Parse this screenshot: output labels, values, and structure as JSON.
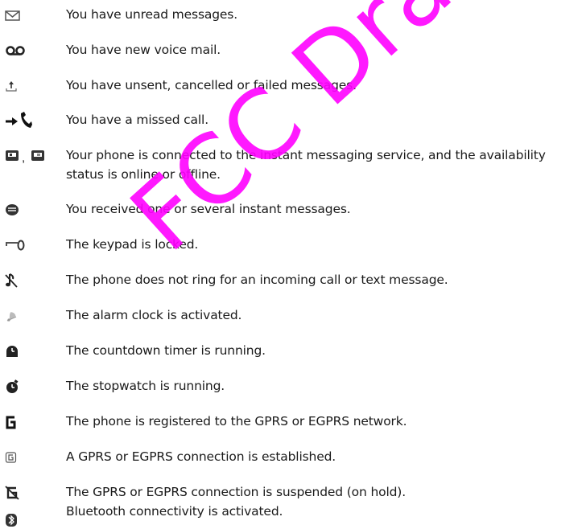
{
  "watermark": {
    "text": "FCC Draft",
    "color": "#ff00ff"
  },
  "items": [
    {
      "icon": "envelope-icon",
      "text": "You have unread messages."
    },
    {
      "icon": "voicemail-icon",
      "text": "You have new voice mail."
    },
    {
      "icon": "outbox-icon",
      "text": "You have unsent, cancelled or failed messages."
    },
    {
      "icon": "missed-call-icon",
      "text": "You have a missed call."
    },
    {
      "icon": "instant-messaging-status-icons",
      "text": "Your phone is connected to the instant messaging service, and the availability status is online or offline."
    },
    {
      "icon": "instant-message-icon",
      "text": "You received one or several instant messages."
    },
    {
      "icon": "key-lock-icon",
      "text": "The keypad is locked."
    },
    {
      "icon": "silent-note-icon",
      "text": "The phone does not ring for an incoming call or text message."
    },
    {
      "icon": "alarm-bell-icon",
      "text": "The alarm clock is activated."
    },
    {
      "icon": "countdown-timer-icon",
      "text": "The countdown timer is running."
    },
    {
      "icon": "stopwatch-icon",
      "text": "The stopwatch is running."
    },
    {
      "icon": "gprs-g-icon",
      "text": "The phone is registered to the GPRS or EGPRS network."
    },
    {
      "icon": "gprs-connected-icon",
      "text": "A GPRS or EGPRS connection is established."
    },
    {
      "icon": "gprs-suspended-icon",
      "text": "The GPRS or EGPRS connection is suspended (on hold)."
    },
    {
      "icon": "bluetooth-icon",
      "text": "Bluetooth connectivity is activated."
    }
  ]
}
